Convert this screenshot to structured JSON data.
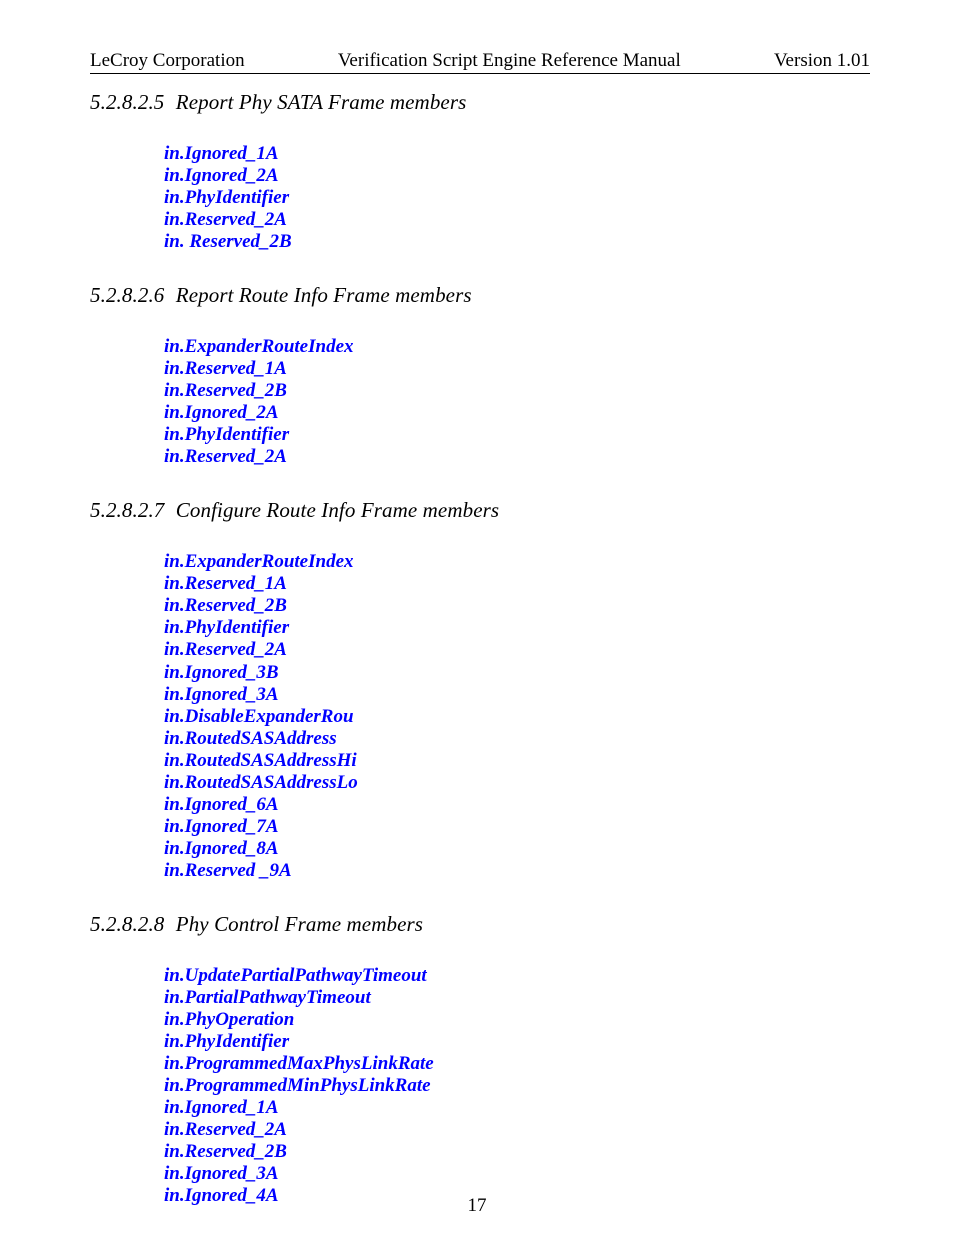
{
  "header": {
    "left": "LeCroy Corporation",
    "center": "Verification Script Engine Reference Manual",
    "right": "Version 1.01"
  },
  "sections": [
    {
      "number": "5.2.8.2.5",
      "title": "Report Phy SATA Frame members",
      "members": [
        "in.Ignored_1A",
        "in.Ignored_2A",
        "in.PhyIdentifier",
        "in.Reserved_2A",
        "in. Reserved_2B"
      ]
    },
    {
      "number": "5.2.8.2.6",
      "title": "Report Route Info Frame members",
      "members": [
        "in.ExpanderRouteIndex",
        "in.Reserved_1A",
        "in.Reserved_2B",
        "in.Ignored_2A",
        "in.PhyIdentifier",
        "in.Reserved_2A"
      ]
    },
    {
      "number": "5.2.8.2.7",
      "title": "Configure Route Info Frame members",
      "members": [
        "in.ExpanderRouteIndex",
        "in.Reserved_1A",
        "in.Reserved_2B",
        "in.PhyIdentifier",
        "in.Reserved_2A",
        "in.Ignored_3B",
        "in.Ignored_3A",
        "in.DisableExpanderRou",
        "in.RoutedSASAddress",
        "in.RoutedSASAddressHi",
        "in.RoutedSASAddressLo",
        "in.Ignored_6A",
        "in.Ignored_7A",
        "in.Ignored_8A",
        "in.Reserved _9A"
      ]
    },
    {
      "number": "5.2.8.2.8",
      "title": "Phy Control Frame members",
      "members": [
        "in.UpdatePartialPathwayTimeout",
        "in.PartialPathwayTimeout",
        "in.PhyOperation",
        "in.PhyIdentifier",
        "in.ProgrammedMaxPhysLinkRate",
        "in.ProgrammedMinPhysLinkRate",
        "in.Ignored_1A",
        "in.Reserved_2A",
        "in.Reserved_2B",
        "in.Ignored_3A",
        "in.Ignored_4A"
      ]
    }
  ],
  "page_number": "17"
}
